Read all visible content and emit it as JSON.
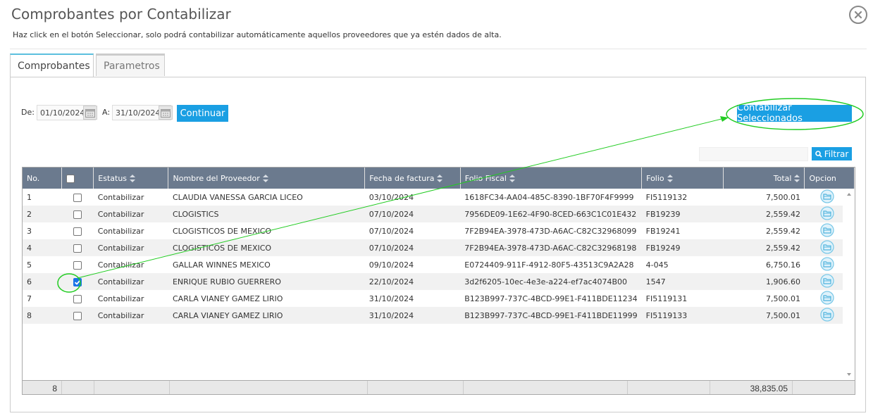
{
  "title": "Comprobantes por Contabilizar",
  "subtitle": "Haz click en el botón Seleccionar, solo podrá contabilizar automáticamente aquellos proveedores que ya estén dados de alta.",
  "tabs": [
    {
      "label": "Comprobantes",
      "active": true
    },
    {
      "label": "Parametros",
      "active": false
    }
  ],
  "filters": {
    "from_label": "De:",
    "from_value": "01/10/2024",
    "to_label": "A:",
    "to_value": "31/10/2024",
    "continue_label": "Continuar",
    "contabilizar_label": "Contabilizar Seleccionados",
    "filter_label": "Filtrar"
  },
  "table": {
    "headers": [
      "No.",
      "",
      "Estatus",
      "Nombre del Proveedor",
      "Fecha de factura",
      "Folio Fiscal",
      "Folio",
      "Total",
      "Opcion"
    ],
    "rows": [
      {
        "no": "1",
        "checked": false,
        "estatus": "Contabilizar",
        "proveedor": "CLAUDIA VANESSA GARCIA LICEO",
        "fecha": "03/10/2024",
        "folio_fiscal": "1618FC34-AA04-485C-8390-1BF70F4F9999",
        "folio": "FI5119132",
        "total": "7,500.01"
      },
      {
        "no": "2",
        "checked": false,
        "estatus": "Contabilizar",
        "proveedor": "CLOGISTICS",
        "fecha": "07/10/2024",
        "folio_fiscal": "7956DE09-1E62-4F90-8CED-663C1C01E432",
        "folio": "FB19239",
        "total": "2,559.42"
      },
      {
        "no": "3",
        "checked": false,
        "estatus": "Contabilizar",
        "proveedor": "CLOGISTICOS DE MEXICO",
        "fecha": "07/10/2024",
        "folio_fiscal": "7F2B94EA-3978-473D-A6AC-C82C32968099",
        "folio": "FB19241",
        "total": "2,559.42"
      },
      {
        "no": "4",
        "checked": false,
        "estatus": "Contabilizar",
        "proveedor": "CLOGISTICOS DE MEXICO",
        "fecha": "07/10/2024",
        "folio_fiscal": "7F2B94EA-3978-473D-A6AC-C82C32968198",
        "folio": "FB19249",
        "total": "2,559.42"
      },
      {
        "no": "5",
        "checked": false,
        "estatus": "Contabilizar",
        "proveedor": "GALLAR WINNES MEXICO",
        "fecha": "09/10/2024",
        "folio_fiscal": "E0724409-911F-4912-80F5-43513C9A2A28",
        "folio": "4-045",
        "total": "6,750.16"
      },
      {
        "no": "6",
        "checked": true,
        "estatus": "Contabilizar",
        "proveedor": "ENRIQUE RUBIO GUERRERO",
        "fecha": "22/10/2024",
        "folio_fiscal": "3d2f6205-10ec-4e3e-a224-ef7ac4074B00",
        "folio": "1547",
        "total": "1,906.60"
      },
      {
        "no": "7",
        "checked": false,
        "estatus": "Contabilizar",
        "proveedor": "CARLA VIANEY GAMEZ LIRIO",
        "fecha": "31/10/2024",
        "folio_fiscal": "B123B997-737C-4BCD-99E1-F411BDE11234",
        "folio": "FI5119131",
        "total": "7,500.01"
      },
      {
        "no": "8",
        "checked": false,
        "estatus": "Contabilizar",
        "proveedor": "CARLA VIANEY GAMEZ LIRIO",
        "fecha": "31/10/2024",
        "folio_fiscal": "B123B997-737C-4BCD-99E1-F411BDE11999",
        "folio": "FI5119133",
        "total": "7,500.01"
      }
    ],
    "footer": {
      "count": "8",
      "total": "38,835.05"
    }
  },
  "colors": {
    "accent": "#1a9fe3",
    "header_bg": "#6b7a8e",
    "annotation": "#22cc22"
  }
}
